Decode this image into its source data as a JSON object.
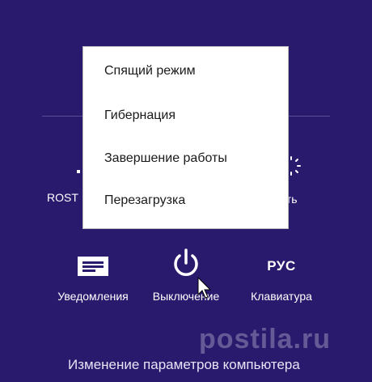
{
  "charms": {
    "user_label": "ROST",
    "brightness_label": "ость",
    "notifications_label": "Уведомления",
    "power_label": "Выключение",
    "keyboard_label": "Клавиатура",
    "keyboard_lang": "РУС",
    "settings_link": "Изменение параметров компьютера"
  },
  "power_menu": {
    "items": [
      "Спящий режим",
      "Гибернация",
      "Завершение работы",
      "Перезагрузка"
    ]
  },
  "watermark": "postila.ru",
  "colors": {
    "background": "#2a1a6e",
    "menu_bg": "#ffffff",
    "text": "#ffffff"
  }
}
